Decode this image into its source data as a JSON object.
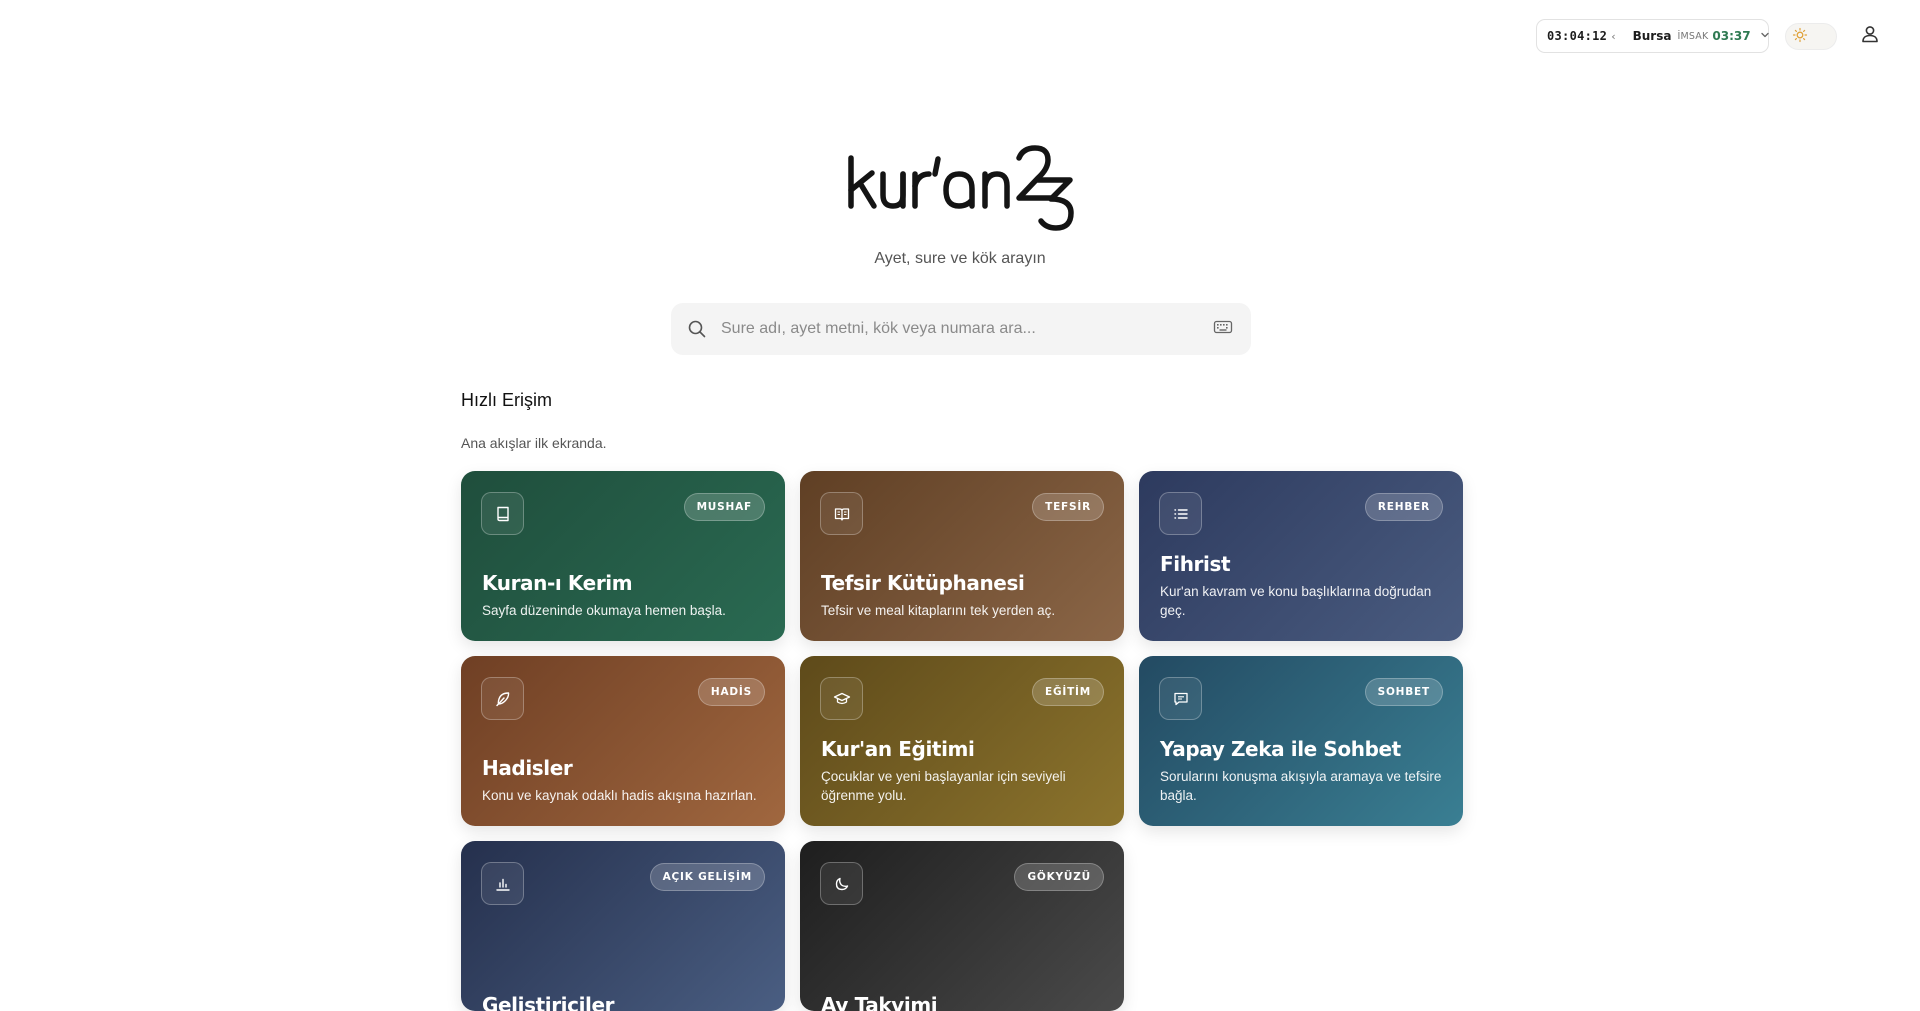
{
  "topbar": {
    "clock": "03:04:12",
    "clock_chevron": "‹",
    "city": "Bursa",
    "prayer_name": "İMSAK",
    "prayer_time": "03:37",
    "theme_icon": "sun-icon",
    "user_icon": "user-icon"
  },
  "hero": {
    "logo_text": "kur'an23",
    "subtitle": "Ayet, sure ve kök arayın",
    "search_placeholder": "Sure adı, ayet metni, kök veya numara ara..."
  },
  "quick_access": {
    "title": "Hızlı Erişim",
    "subtitle": "Ana akışlar ilk ekranda.",
    "cards": [
      {
        "badge": "MUSHAF",
        "title": "Kuran-ı Kerim",
        "desc": "Sayfa düzeninde okumaya hemen başla.",
        "icon": "book-icon",
        "color": "#1f4e3c"
      },
      {
        "badge": "TEFSİR",
        "title": "Tefsir Kütüphanesi",
        "desc": "Tefsir ve meal kitaplarını tek yerden aç.",
        "icon": "open-book-icon",
        "color": "#5f3f24"
      },
      {
        "badge": "REHBER",
        "title": "Fihrist",
        "desc": "Kur'an kavram ve konu başlıklarına doğrudan geç.",
        "icon": "list-icon",
        "color": "#2d3a5e"
      },
      {
        "badge": "HADİS",
        "title": "Hadisler",
        "desc": "Konu ve kaynak odaklı hadis akışına hazırlan.",
        "icon": "feather-icon",
        "color": "#6f3f24"
      },
      {
        "badge": "EĞİTİM",
        "title": "Kur'an Eğitimi",
        "desc": "Çocuklar ve yeni başlayanlar için seviyeli öğrenme yolu.",
        "icon": "graduation-cap-icon",
        "color": "#5e4a1a"
      },
      {
        "badge": "SOHBET",
        "title": "Yapay Zeka ile Sohbet",
        "desc": "Sorularını konuşma akışıyla aramaya ve tefsire bağla.",
        "icon": "chat-icon",
        "color": "#234a62"
      },
      {
        "badge": "AÇIK GELİŞİM",
        "title": "Geliştiriciler",
        "desc": "",
        "icon": "bar-chart-icon",
        "color": "#25304d"
      },
      {
        "badge": "GÖKYÜZÜ",
        "title": "Ay Takvimi",
        "desc": "",
        "icon": "moon-icon",
        "color": "#1e1e1e"
      }
    ]
  }
}
